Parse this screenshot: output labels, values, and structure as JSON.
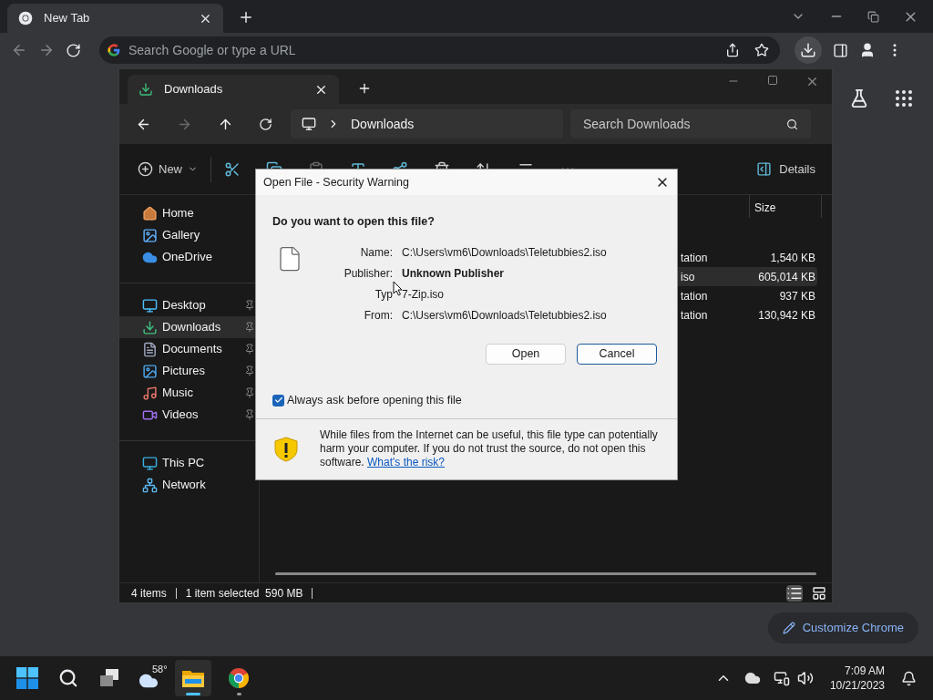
{
  "browser": {
    "tabs": [
      {
        "title": "New Tab",
        "selected": true
      }
    ],
    "omnibox": {
      "placeholder": "Search Google or type a URL"
    },
    "customize_button": "Customize Chrome"
  },
  "explorer": {
    "tabs": [
      {
        "title": "Downloads",
        "selected": true
      }
    ],
    "breadcrumb": [
      "Downloads"
    ],
    "search": {
      "placeholder": "Search Downloads"
    },
    "toolbar": {
      "new": "New",
      "details": "Details"
    },
    "sidebar": [
      [
        {
          "label": "Home",
          "kind": "home",
          "selected": false,
          "pinned": false
        },
        {
          "label": "Gallery",
          "kind": "gallery",
          "selected": false,
          "pinned": false
        },
        {
          "label": "OneDrive",
          "kind": "cloud",
          "selected": false,
          "pinned": false
        }
      ],
      [
        {
          "label": "Desktop",
          "kind": "desktop",
          "selected": false,
          "pinned": true
        },
        {
          "label": "Downloads",
          "kind": "download",
          "selected": true,
          "pinned": true
        },
        {
          "label": "Documents",
          "kind": "document",
          "selected": false,
          "pinned": true
        },
        {
          "label": "Pictures",
          "kind": "pictures",
          "selected": false,
          "pinned": true
        },
        {
          "label": "Music",
          "kind": "music",
          "selected": false,
          "pinned": true
        },
        {
          "label": "Videos",
          "kind": "videos",
          "selected": false,
          "pinned": true
        }
      ],
      [
        {
          "label": "This PC",
          "kind": "pc",
          "selected": false,
          "pinned": false
        },
        {
          "label": "Network",
          "kind": "network",
          "selected": false,
          "pinned": false
        }
      ]
    ],
    "columns": [
      {
        "label": "Size"
      }
    ],
    "rows": [
      {
        "type": "tation",
        "size": "1,540 KB",
        "selected": false
      },
      {
        "type": "iso",
        "size": "605,014 KB",
        "selected": true
      },
      {
        "type": "tation",
        "size": "937 KB",
        "selected": false
      },
      {
        "type": "tation",
        "size": "130,942 KB",
        "selected": false
      }
    ],
    "status": [
      "4 items",
      "1 item selected  590 MB"
    ]
  },
  "dialog": {
    "title": "Open File - Security Warning",
    "question": "Do you want to open this file?",
    "fields": [
      {
        "label": "Name:",
        "value": "C:\\Users\\vm6\\Downloads\\Teletubbies2.iso",
        "emphasis": false,
        "cursor": false
      },
      {
        "label": "Publisher:",
        "value": "Unknown Publisher",
        "emphasis": true,
        "cursor": false
      },
      {
        "label": "Typ",
        "value": "7-Zip.iso",
        "emphasis": false,
        "cursor": true
      },
      {
        "label": "From:",
        "value": "C:\\Users\\vm6\\Downloads\\Teletubbies2.iso",
        "emphasis": false,
        "cursor": false
      }
    ],
    "buttons": [
      {
        "label": "Open",
        "default": false
      },
      {
        "label": "Cancel",
        "default": true
      }
    ],
    "checkbox": {
      "label": "Always ask before opening this file",
      "checked": true
    },
    "warning": {
      "text": "While files from the Internet can be useful, this file type can potentially harm your computer. If you do not trust the source, do not open this software.",
      "link": "What's the risk?"
    }
  },
  "taskbar": {
    "weather": "58°",
    "apps": [
      {
        "kind": "explorer",
        "active": true
      },
      {
        "kind": "chrome",
        "active": false
      }
    ],
    "time": "7:09 AM",
    "date": "10/21/2023"
  }
}
